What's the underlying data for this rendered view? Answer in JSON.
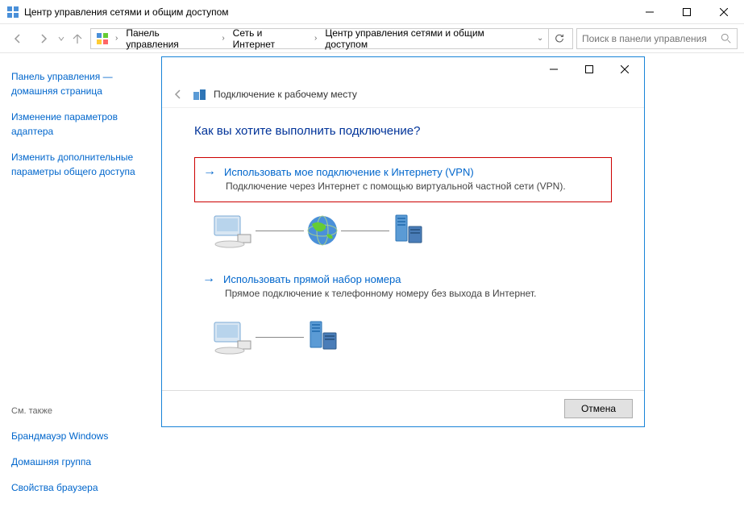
{
  "window": {
    "title": "Центр управления сетями и общим доступом"
  },
  "breadcrumb": {
    "item0": "Панель управления",
    "item1": "Сеть и Интернет",
    "item2": "Центр управления сетями и общим доступом"
  },
  "search": {
    "placeholder": "Поиск в панели управления"
  },
  "sidebar": {
    "link0": "Панель управления — домашняя страница",
    "link1": "Изменение параметров адаптера",
    "link2": "Изменить дополнительные параметры общего доступа",
    "also_label": "См. также",
    "also0": "Брандмауэр Windows",
    "also1": "Домашняя группа",
    "also2": "Свойства браузера"
  },
  "dialog": {
    "header": "Подключение к рабочему месту",
    "question": "Как вы хотите выполнить подключение?",
    "option_vpn": {
      "title": "Использовать мое подключение к Интернету (VPN)",
      "desc": "Подключение через Интернет с помощью виртуальной частной сети (VPN)."
    },
    "option_dial": {
      "title": "Использовать прямой набор номера",
      "desc": "Прямое подключение к телефонному номеру без выхода в Интернет."
    },
    "cancel": "Отмена"
  }
}
